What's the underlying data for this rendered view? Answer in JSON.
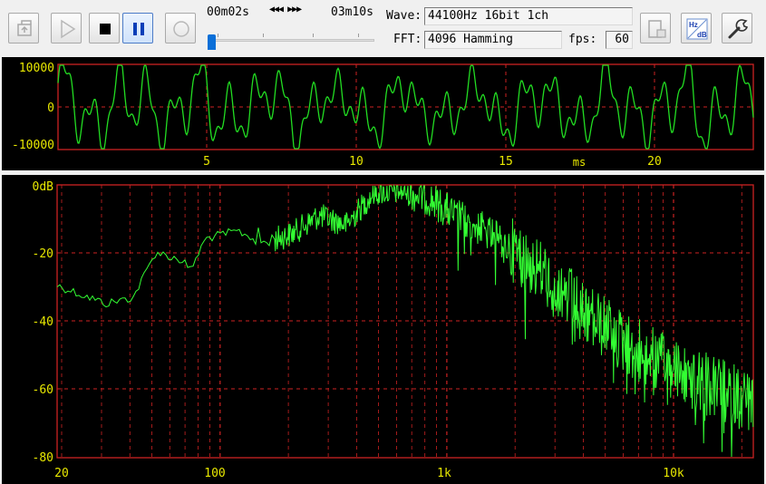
{
  "toolbar": {
    "buttons": [
      {
        "name": "open-file-button",
        "icon": "open-file-icon",
        "enabled": false
      },
      {
        "name": "play-button",
        "icon": "play-icon",
        "enabled": false
      },
      {
        "name": "stop-button",
        "icon": "stop-icon",
        "enabled": true
      },
      {
        "name": "pause-button",
        "icon": "pause-icon",
        "enabled": true,
        "active": true
      },
      {
        "name": "record-button",
        "icon": "record-icon",
        "enabled": false
      }
    ],
    "elapsed": "00m02s",
    "seek_glyphs": "◀◀◀ ▶▶▶",
    "total": "03m10s",
    "position_fraction": 0.011,
    "wave_label": "Wave:",
    "wave_value": "44100Hz 16bit 1ch",
    "fft_label": "FFT:",
    "fft_value": "4096 Hamming",
    "fps_label": "fps:",
    "fps_value": "60",
    "right_buttons": [
      {
        "name": "export-button",
        "icon": "export-icon",
        "enabled": false
      },
      {
        "name": "unit-toggle-button",
        "icon": "hz-db-icon",
        "text_top": "Hz",
        "text_bottom": "dB"
      },
      {
        "name": "settings-button",
        "icon": "wrench-icon"
      }
    ]
  },
  "waveform": {
    "y_ticks": [
      "10000",
      "0",
      "-10000"
    ],
    "x_ticks": [
      "5",
      "10",
      "15",
      "20"
    ],
    "x_unit": "ms",
    "colors": {
      "trace": "#22dd22",
      "grid": "#cc2222",
      "text": "#e8e800",
      "axis_bg": "#000000"
    }
  },
  "spectrum": {
    "y_ticks": [
      "0dB",
      "-20",
      "-40",
      "-60",
      "-80"
    ],
    "x_ticks": [
      "20",
      "100",
      "1k",
      "10k"
    ],
    "colors": {
      "trace": "#33ff33",
      "grid": "#cc2222",
      "text": "#e8e800"
    }
  }
}
